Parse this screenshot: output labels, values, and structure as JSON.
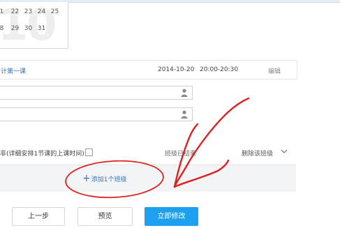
{
  "calendar": {
    "watermark": "10",
    "row1": [
      "1",
      "22",
      "23",
      "24",
      "25"
    ],
    "row2": [
      "8",
      "29",
      "30",
      "31"
    ]
  },
  "lesson": {
    "title": "计第一课",
    "date": "2014-10-20",
    "time": "20:00-20:30",
    "edit_label": "编辑"
  },
  "inputs": [
    {
      "value": "",
      "icon": "person-icon"
    },
    {
      "value": "",
      "icon": "person-icon"
    }
  ],
  "schedule": {
    "text": "非(详细安排1节课的上课时间)",
    "status": "班级已结束",
    "delete_label": "删除该班级"
  },
  "add_class": {
    "label": "添加1个班级",
    "icon": "plus-icon"
  },
  "buttons": {
    "prev": "上一步",
    "preview": "预览",
    "save": "立即修改"
  },
  "colors": {
    "accent": "#1ea0f0",
    "link": "#2f74c0",
    "annotation": "#e02020"
  }
}
